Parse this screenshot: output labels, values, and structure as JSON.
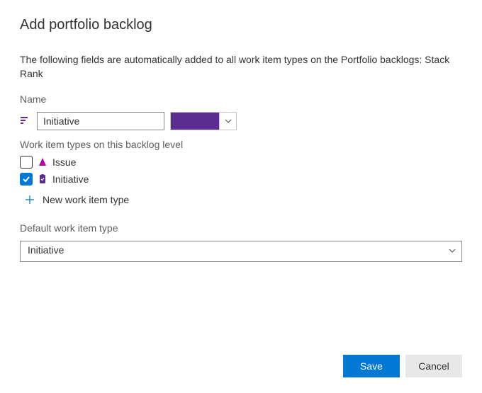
{
  "dialog": {
    "title": "Add portfolio backlog",
    "description": "The following fields are automatically added to all work item types on the Portfolio backlogs: Stack Rank"
  },
  "nameField": {
    "label": "Name",
    "value": "Initiative",
    "color": "#5C2D91"
  },
  "workItemTypes": {
    "label": "Work item types on this backlog level",
    "items": [
      {
        "name": "Issue",
        "checked": false,
        "iconColor": "#B4009E"
      },
      {
        "name": "Initiative",
        "checked": true,
        "iconColor": "#5C2D91"
      }
    ],
    "addLabel": "New work item type"
  },
  "defaultType": {
    "label": "Default work item type",
    "value": "Initiative"
  },
  "footer": {
    "save": "Save",
    "cancel": "Cancel"
  }
}
